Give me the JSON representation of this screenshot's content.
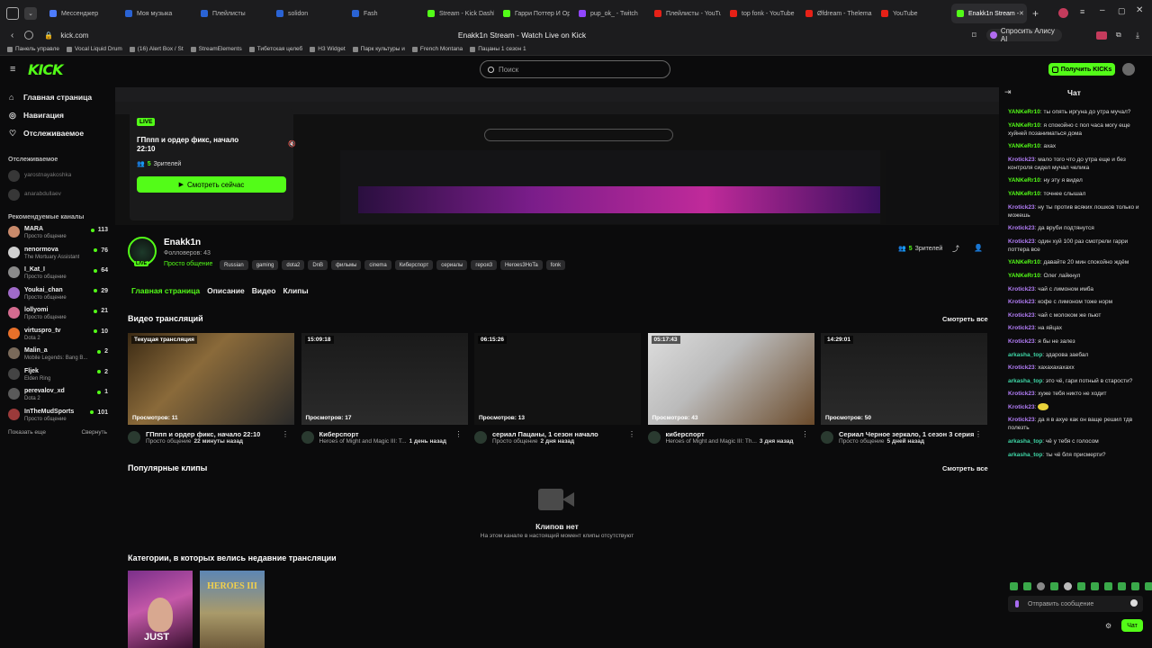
{
  "browser": {
    "tabs": [
      {
        "label": "Мессенджер",
        "color": "#4d7cfe"
      },
      {
        "label": "Моя музыка",
        "color": "#2a63d4"
      },
      {
        "label": "Плейлисты",
        "color": "#2a63d4"
      },
      {
        "label": "solidon",
        "color": "#2a63d4"
      },
      {
        "label": "Fash",
        "color": "#2a63d4"
      },
      {
        "label": "Stream - Kick Dashb",
        "color": "#53fc18"
      },
      {
        "label": "Гарри Поттер И Ор",
        "color": "#53fc18"
      },
      {
        "label": "pup_ok_ - Twitch",
        "color": "#9146ff"
      },
      {
        "label": "Плейлисты - YouTub",
        "color": "#e62117"
      },
      {
        "label": "top fonk - YouTube",
        "color": "#e62117"
      },
      {
        "label": "Øfdream - Thelema",
        "color": "#e62117"
      },
      {
        "label": "YouTube",
        "color": "#e62117"
      },
      {
        "label": "Enakk1n Stream - ",
        "color": "#53fc18"
      }
    ],
    "url": "kick.com",
    "page_title": "Enakk1n Stream - Watch Live on Kick",
    "alice_label": "Спросить Алису AI",
    "bookmarks": [
      "Панель управле",
      "Vocal Liquid Drum",
      "(16) Alert Box / St",
      "StreamElements",
      "Тибетская целеб",
      "H3 Widget",
      "Парк культуры и",
      "French Montana",
      "Пацаны 1 сезон 1"
    ]
  },
  "header": {
    "logo": "KICK",
    "search_placeholder": "Поиск",
    "kicks_button": "Получить KICKs"
  },
  "sidebar": {
    "nav": [
      {
        "label": "Главная страница",
        "icon": "home-icon"
      },
      {
        "label": "Навигация",
        "icon": "compass-icon"
      },
      {
        "label": "Отслеживаемое",
        "icon": "heart-icon"
      }
    ],
    "followed_title": "Отслеживаемое",
    "followed": [
      "yarostnayakoshka",
      "anarabdullaev"
    ],
    "recommended_title": "Рекомендуемые каналы",
    "recommended": [
      {
        "name": "MARA",
        "sub": "Просто общение",
        "viewers": "113",
        "color": "#c98a6b"
      },
      {
        "name": "nenormova",
        "sub": "The Mortuary Assistant",
        "viewers": "76",
        "color": "#d0d0d0"
      },
      {
        "name": "I_Kat_I",
        "sub": "Просто общение",
        "viewers": "64",
        "color": "#8a8a8a"
      },
      {
        "name": "Youkai_chan",
        "sub": "Просто общение",
        "viewers": "29",
        "color": "#a06ac9"
      },
      {
        "name": "lollyomi",
        "sub": "Просто общение",
        "viewers": "21",
        "color": "#d46b8f"
      },
      {
        "name": "virtuspro_tv",
        "sub": "Dota 2",
        "viewers": "10",
        "color": "#e8702a"
      },
      {
        "name": "Malin_a",
        "sub": "Mobile Legends: Bang B...",
        "viewers": "2",
        "color": "#7a6a5a"
      },
      {
        "name": "Fljek",
        "sub": "Elden Ring",
        "viewers": "2",
        "color": "#444"
      },
      {
        "name": "perevalov_xd",
        "sub": "Dota 2",
        "viewers": "1",
        "color": "#5a5a5a"
      },
      {
        "name": "InTheMudSports",
        "sub": "Просто общение",
        "viewers": "101",
        "color": "#9b3a3a"
      }
    ],
    "show_more": "Показать еще",
    "collapse": "Свернуть"
  },
  "player": {
    "popup": {
      "live_badge": "LIVE",
      "title": "ГПппп и ордер фикс, начало 22:10",
      "viewers_count": "5",
      "viewers_label": "Зрителей",
      "watch_button": "Смотреть сейчас"
    }
  },
  "channel": {
    "name": "Enakk1n",
    "live_badge": "LIVE",
    "followers": "Фолловеров: 43",
    "category": "Просто общение",
    "tags": [
      "Russian",
      "gaming",
      "dota2",
      "DnB",
      "фильмы",
      "cinema",
      "Киберспорт",
      "сериалы",
      "героя3",
      "Heroes3HoTa",
      "fonk"
    ],
    "viewers_count": "5",
    "viewers_label": "Зрителей",
    "tabs": [
      "Главная страница",
      "Описание",
      "Видео",
      "Клипы"
    ]
  },
  "videos": {
    "title": "Видео трансляций",
    "see_all": "Смотреть все",
    "items": [
      {
        "badge": "Текущая трансляция",
        "views": "Просмотров: 11",
        "title": "ГПппп и ордер фикс, начало 22:10",
        "category": "Просто общение",
        "ago": "22 минуты назад"
      },
      {
        "badge": "15:09:18",
        "views": "Просмотров: 17",
        "title": "Киберспорт",
        "category": "Heroes of Might and Magic III: T...",
        "ago": "1 день назад"
      },
      {
        "badge": "06:15:26",
        "views": "Просмотров: 13",
        "title": "сериал Пацаны, 1 сезон начало",
        "category": "Просто общение",
        "ago": "2 дня назад"
      },
      {
        "badge": "05:17:43",
        "views": "Просмотров: 43",
        "title": "киберспорт",
        "category": "Heroes of Might and Magic III: Th...",
        "ago": "3 дня назад"
      },
      {
        "badge": "14:29:01",
        "views": "Просмотров: 50",
        "title": "Сериал Черное зеркало, 1 сезон 3 серия",
        "category": "Просто общение",
        "ago": "5 дней назад"
      }
    ]
  },
  "clips": {
    "title": "Популярные клипы",
    "see_all": "Смотреть все",
    "empty_title": "Клипов нет",
    "empty_sub": "На этом канале в настоящий момент клипы отсутствуют"
  },
  "categories": {
    "title": "Категории, в которых велись недавние трансляции",
    "items": [
      "JUST",
      "HEROES III"
    ]
  },
  "chat": {
    "title": "Чат",
    "messages": [
      {
        "user": "YANKeRr10",
        "color": "green",
        "text": "ты опять иргуна до утра мучал?"
      },
      {
        "user": "YANKeRr10",
        "color": "green",
        "text": "я спокойно с пол часа могу еще хуйней позаниматься дома"
      },
      {
        "user": "YANKeRr10",
        "color": "green",
        "text": "ахах"
      },
      {
        "user": "Krotick23",
        "color": "purple",
        "text": "мало того что до утра еще и без контроля сидел мучал челика"
      },
      {
        "user": "YANKeRr10",
        "color": "green",
        "text": "ну эту я видел"
      },
      {
        "user": "YANKeRr10",
        "color": "green",
        "text": "точнее слышал"
      },
      {
        "user": "Krotick23",
        "color": "purple",
        "text": "ну ты против всяких лошков только и можешь"
      },
      {
        "user": "Krotick23",
        "color": "purple",
        "text": "да вруби подтянутся"
      },
      {
        "user": "Krotick23",
        "color": "purple",
        "text": "один хуй 100 раз смотрели гарри поттера все"
      },
      {
        "user": "YANKeRr10",
        "color": "green",
        "text": "давайте 20 мин спокойно ждём"
      },
      {
        "user": "YANKeRr10",
        "color": "green",
        "text": "Олег лайкнул"
      },
      {
        "user": "Krotick23",
        "color": "purple",
        "text": "чай с лимоном имба"
      },
      {
        "user": "Krotick23",
        "color": "purple",
        "text": "кофе с лимоном тоже норм"
      },
      {
        "user": "Krotick23",
        "color": "purple",
        "text": "чай с молоком же пьют"
      },
      {
        "user": "Krotick23",
        "color": "purple",
        "text": "на яйцах"
      },
      {
        "user": "Krotick23",
        "color": "purple",
        "text": "я бы не залез"
      },
      {
        "user": "arkasha_top",
        "color": "teal",
        "text": "здарова заебал"
      },
      {
        "user": "Krotick23",
        "color": "purple",
        "text": "хахахахахахх"
      },
      {
        "user": "arkasha_top",
        "color": "teal",
        "text": "это чё, гари потный в старости?"
      },
      {
        "user": "Krotick23",
        "color": "purple",
        "text": "хуже тебя никто не ходит"
      },
      {
        "user": "Krotick23",
        "color": "purple",
        "text": ""
      },
      {
        "user": "Krotick23",
        "color": "purple",
        "text": "да я в ахуе как он ваще решил тдв полезть"
      },
      {
        "user": "arkasha_top",
        "color": "teal",
        "text": "чё у тебя с голосом"
      },
      {
        "user": "arkasha_top",
        "color": "teal",
        "text": "ты чё бля присмерти?"
      }
    ],
    "input_placeholder": "Отправить сообщение",
    "send_button": "Чат"
  }
}
